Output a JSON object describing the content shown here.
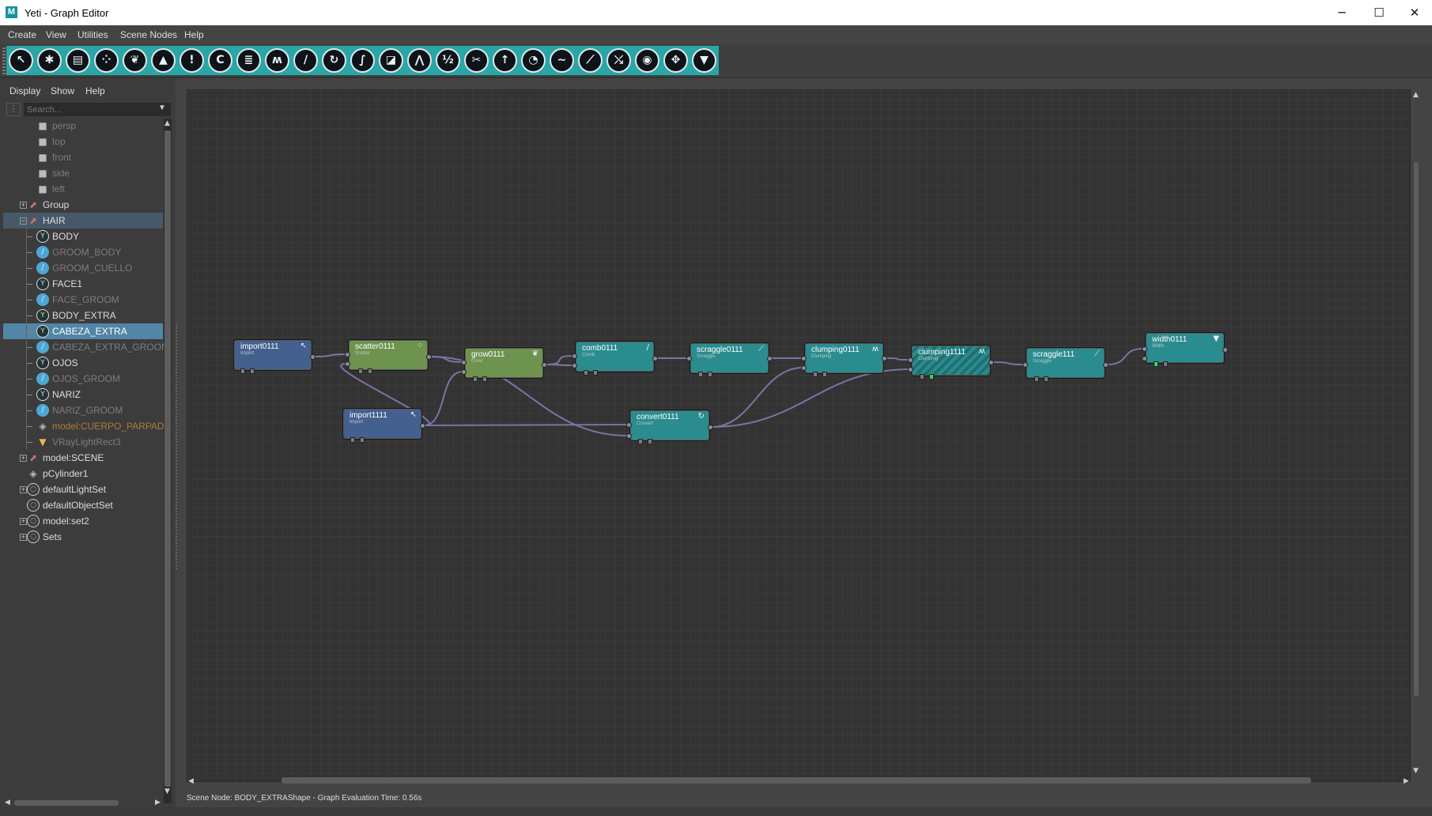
{
  "window": {
    "title": "Yeti - Graph Editor",
    "logo_letter": "M",
    "minimize": "─",
    "maximize": "☐",
    "close": "✕"
  },
  "menubar": [
    "Create",
    "View",
    "Utilities",
    "Scene Nodes",
    "Help"
  ],
  "toolbar": {
    "accent_color": "#2aa6a6",
    "buttons": [
      {
        "icon": "select-arrow-icon",
        "glyph": "↖"
      },
      {
        "icon": "scene-settings-icon",
        "glyph": "✱"
      },
      {
        "icon": "archive-icon",
        "glyph": "▤"
      },
      {
        "icon": "scatter-icon",
        "glyph": "⁘"
      },
      {
        "icon": "grow-icon",
        "glyph": "❦"
      },
      {
        "icon": "bucket-icon",
        "glyph": "▲"
      },
      {
        "icon": "attention-icon",
        "glyph": "!"
      },
      {
        "icon": "curl-icon",
        "glyph": "C"
      },
      {
        "icon": "stack-icon",
        "glyph": "≣"
      },
      {
        "icon": "clumping-icon",
        "glyph": "ʍ"
      },
      {
        "icon": "comb-icon",
        "glyph": "/"
      },
      {
        "icon": "rotate-icon",
        "glyph": "↻"
      },
      {
        "icon": "braid-icon",
        "glyph": "∫"
      },
      {
        "icon": "texture-icon",
        "glyph": "◪"
      },
      {
        "icon": "noise-icon",
        "glyph": "⋀"
      },
      {
        "icon": "split-12-icon",
        "glyph": "½"
      },
      {
        "icon": "cut-icon",
        "glyph": "✂"
      },
      {
        "icon": "direction-icon",
        "glyph": "↑"
      },
      {
        "icon": "clock-icon",
        "glyph": "◔"
      },
      {
        "icon": "curve-icon",
        "glyph": "∼"
      },
      {
        "icon": "scraggle-icon",
        "glyph": "⟋"
      },
      {
        "icon": "random-icon",
        "glyph": "⤯"
      },
      {
        "icon": "palette-icon",
        "glyph": "◉"
      },
      {
        "icon": "move-icon",
        "glyph": "✥"
      },
      {
        "icon": "width-icon",
        "glyph": "▼"
      }
    ]
  },
  "outliner": {
    "menu": [
      "Display",
      "Show",
      "Help"
    ],
    "search_placeholder": "Search...",
    "items": [
      {
        "label": "persp",
        "icon": "camera-icon",
        "glyph": "■",
        "indent": 1,
        "style": "dim"
      },
      {
        "label": "top",
        "icon": "camera-icon",
        "glyph": "■",
        "indent": 1,
        "style": "dim"
      },
      {
        "label": "front",
        "icon": "camera-icon",
        "glyph": "■",
        "indent": 1,
        "style": "dim"
      },
      {
        "label": "side",
        "icon": "camera-icon",
        "glyph": "■",
        "indent": 1,
        "style": "dim"
      },
      {
        "label": "left",
        "icon": "camera-icon",
        "glyph": "■",
        "indent": 1,
        "style": "dim"
      },
      {
        "label": "Group",
        "icon": "group-icon",
        "glyph": "⬈",
        "indent": 0,
        "expander": "+",
        "style": "normal"
      },
      {
        "label": "HAIR",
        "icon": "group-icon",
        "glyph": "⬈",
        "indent": 0,
        "expander": "−",
        "style": "hair"
      },
      {
        "label": "BODY",
        "icon": "yeti-node-icon",
        "glyph": "Y",
        "indent": 2,
        "style": "normal"
      },
      {
        "label": "GROOM_BODY",
        "icon": "groom-icon",
        "glyph": "/",
        "indent": 2,
        "style": "dim"
      },
      {
        "label": "GROOM_CUELLO",
        "icon": "groom-icon",
        "glyph": "/",
        "indent": 2,
        "style": "dim"
      },
      {
        "label": "FACE1",
        "icon": "yeti-node-icon",
        "glyph": "Y",
        "indent": 2,
        "style": "normal"
      },
      {
        "label": "FACE_GROOM",
        "icon": "groom-icon",
        "glyph": "/",
        "indent": 2,
        "style": "dim"
      },
      {
        "label": "BODY_EXTRA",
        "icon": "yeti-node-icon",
        "glyph": "Y",
        "indent": 2,
        "style": "normal"
      },
      {
        "label": "CABEZA_EXTRA",
        "icon": "yeti-node-icon",
        "glyph": "Y",
        "indent": 2,
        "style": "selected"
      },
      {
        "label": "CABEZA_EXTRA_GROOM",
        "icon": "groom-icon",
        "glyph": "/",
        "indent": 2,
        "style": "dim"
      },
      {
        "label": "OJOS",
        "icon": "yeti-node-icon",
        "glyph": "Y",
        "indent": 2,
        "style": "normal"
      },
      {
        "label": "OJOS_GROOM",
        "icon": "groom-icon",
        "glyph": "/",
        "indent": 2,
        "style": "dim"
      },
      {
        "label": "NARIZ",
        "icon": "yeti-node-icon",
        "glyph": "Y",
        "indent": 2,
        "style": "normal"
      },
      {
        "label": "NARIZ_GROOM",
        "icon": "groom-icon",
        "glyph": "/",
        "indent": 2,
        "style": "dim"
      },
      {
        "label": "model:CUERPO_PARPADO",
        "icon": "mesh-icon",
        "glyph": "◈",
        "indent": 2,
        "style": "orange"
      },
      {
        "label": "VRayLightRect3",
        "icon": "light-icon",
        "glyph": "▼",
        "indent": 2,
        "style": "dim"
      },
      {
        "label": "model:SCENE",
        "icon": "group-icon",
        "glyph": "⬈",
        "indent": 0,
        "expander": "+",
        "style": "normal"
      },
      {
        "label": "pCylinder1",
        "icon": "mesh-icon",
        "glyph": "◈",
        "indent": 0,
        "style": "normal"
      },
      {
        "label": "defaultLightSet",
        "icon": "set-icon",
        "glyph": "◌",
        "indent": 0,
        "expander": "+",
        "style": "normal"
      },
      {
        "label": "defaultObjectSet",
        "icon": "set-icon",
        "glyph": "◌",
        "indent": 0,
        "style": "normal"
      },
      {
        "label": "model:set2",
        "icon": "set-icon",
        "glyph": "◌",
        "indent": 0,
        "expander": "+",
        "style": "normal"
      },
      {
        "label": "Sets",
        "icon": "set-icon",
        "glyph": "◌",
        "indent": 0,
        "expander": "+",
        "style": "normal"
      }
    ]
  },
  "graph": {
    "colors": {
      "import": "#44608e",
      "scatter_grow": "#6e934f",
      "other": "#2b8c8f",
      "edge": "#7b74a6"
    },
    "nodes": [
      {
        "id": "import0111",
        "name": "import0111",
        "type": "Import",
        "color": "blue",
        "icon": "import-arrow-icon",
        "glyph": "↖"
      },
      {
        "id": "scatter0111",
        "name": "scatter0111",
        "type": "Scatter",
        "color": "green",
        "icon": "scatter-icon",
        "glyph": "⁘"
      },
      {
        "id": "grow0111",
        "name": "grow0111",
        "type": "Grow",
        "color": "green",
        "icon": "grow-icon",
        "glyph": "❦"
      },
      {
        "id": "comb0111",
        "name": "comb0111",
        "type": "Comb",
        "color": "teal",
        "icon": "comb-icon",
        "glyph": "/"
      },
      {
        "id": "scraggle0111",
        "name": "scraggle0111",
        "type": "Scraggle",
        "color": "teal",
        "icon": "scraggle-icon",
        "glyph": "⟋"
      },
      {
        "id": "clumping0111",
        "name": "clumping0111",
        "type": "Clumping",
        "color": "teal",
        "icon": "clumping-icon",
        "glyph": "ʍ"
      },
      {
        "id": "clumping1111",
        "name": "clumping1111",
        "type": "Clumping",
        "color": "hatched",
        "icon": "clumping-icon",
        "glyph": "ʍ"
      },
      {
        "id": "scraggle111",
        "name": "scraggle111",
        "type": "Scraggle",
        "color": "teal",
        "icon": "scraggle-icon",
        "glyph": "⟋"
      },
      {
        "id": "width0111",
        "name": "width0111",
        "type": "Width",
        "color": "teal",
        "icon": "width-icon",
        "glyph": "▼"
      },
      {
        "id": "import1111",
        "name": "import1111",
        "type": "Import",
        "color": "blue",
        "icon": "import-arrow-icon",
        "glyph": "↖"
      },
      {
        "id": "convert0111",
        "name": "convert0111",
        "type": "Convert",
        "color": "teal",
        "icon": "convert-icon",
        "glyph": "↻"
      }
    ]
  },
  "status": "Scene Node: BODY_EXTRAShape - Graph Evaluation Time: 0.56s"
}
